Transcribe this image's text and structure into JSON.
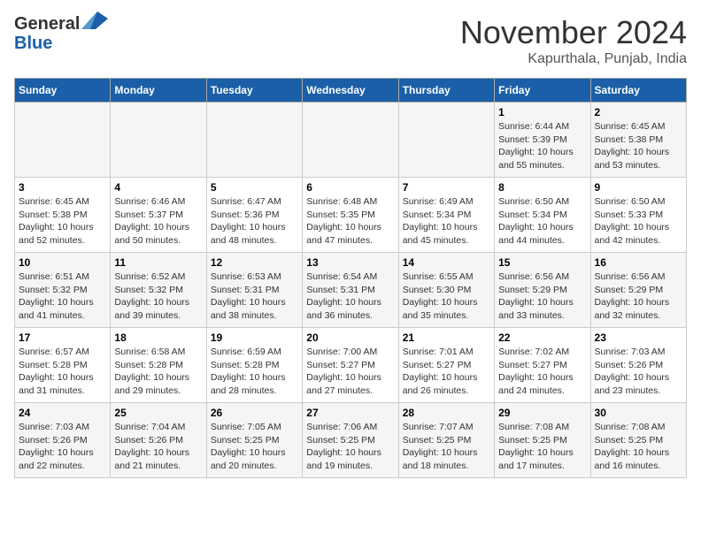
{
  "header": {
    "logo_line1": "General",
    "logo_line2": "Blue",
    "month": "November 2024",
    "location": "Kapurthala, Punjab, India"
  },
  "weekdays": [
    "Sunday",
    "Monday",
    "Tuesday",
    "Wednesday",
    "Thursday",
    "Friday",
    "Saturday"
  ],
  "weeks": [
    [
      {
        "day": "",
        "info": ""
      },
      {
        "day": "",
        "info": ""
      },
      {
        "day": "",
        "info": ""
      },
      {
        "day": "",
        "info": ""
      },
      {
        "day": "",
        "info": ""
      },
      {
        "day": "1",
        "info": "Sunrise: 6:44 AM\nSunset: 5:39 PM\nDaylight: 10 hours and 55 minutes."
      },
      {
        "day": "2",
        "info": "Sunrise: 6:45 AM\nSunset: 5:38 PM\nDaylight: 10 hours and 53 minutes."
      }
    ],
    [
      {
        "day": "3",
        "info": "Sunrise: 6:45 AM\nSunset: 5:38 PM\nDaylight: 10 hours and 52 minutes."
      },
      {
        "day": "4",
        "info": "Sunrise: 6:46 AM\nSunset: 5:37 PM\nDaylight: 10 hours and 50 minutes."
      },
      {
        "day": "5",
        "info": "Sunrise: 6:47 AM\nSunset: 5:36 PM\nDaylight: 10 hours and 48 minutes."
      },
      {
        "day": "6",
        "info": "Sunrise: 6:48 AM\nSunset: 5:35 PM\nDaylight: 10 hours and 47 minutes."
      },
      {
        "day": "7",
        "info": "Sunrise: 6:49 AM\nSunset: 5:34 PM\nDaylight: 10 hours and 45 minutes."
      },
      {
        "day": "8",
        "info": "Sunrise: 6:50 AM\nSunset: 5:34 PM\nDaylight: 10 hours and 44 minutes."
      },
      {
        "day": "9",
        "info": "Sunrise: 6:50 AM\nSunset: 5:33 PM\nDaylight: 10 hours and 42 minutes."
      }
    ],
    [
      {
        "day": "10",
        "info": "Sunrise: 6:51 AM\nSunset: 5:32 PM\nDaylight: 10 hours and 41 minutes."
      },
      {
        "day": "11",
        "info": "Sunrise: 6:52 AM\nSunset: 5:32 PM\nDaylight: 10 hours and 39 minutes."
      },
      {
        "day": "12",
        "info": "Sunrise: 6:53 AM\nSunset: 5:31 PM\nDaylight: 10 hours and 38 minutes."
      },
      {
        "day": "13",
        "info": "Sunrise: 6:54 AM\nSunset: 5:31 PM\nDaylight: 10 hours and 36 minutes."
      },
      {
        "day": "14",
        "info": "Sunrise: 6:55 AM\nSunset: 5:30 PM\nDaylight: 10 hours and 35 minutes."
      },
      {
        "day": "15",
        "info": "Sunrise: 6:56 AM\nSunset: 5:29 PM\nDaylight: 10 hours and 33 minutes."
      },
      {
        "day": "16",
        "info": "Sunrise: 6:56 AM\nSunset: 5:29 PM\nDaylight: 10 hours and 32 minutes."
      }
    ],
    [
      {
        "day": "17",
        "info": "Sunrise: 6:57 AM\nSunset: 5:28 PM\nDaylight: 10 hours and 31 minutes."
      },
      {
        "day": "18",
        "info": "Sunrise: 6:58 AM\nSunset: 5:28 PM\nDaylight: 10 hours and 29 minutes."
      },
      {
        "day": "19",
        "info": "Sunrise: 6:59 AM\nSunset: 5:28 PM\nDaylight: 10 hours and 28 minutes."
      },
      {
        "day": "20",
        "info": "Sunrise: 7:00 AM\nSunset: 5:27 PM\nDaylight: 10 hours and 27 minutes."
      },
      {
        "day": "21",
        "info": "Sunrise: 7:01 AM\nSunset: 5:27 PM\nDaylight: 10 hours and 26 minutes."
      },
      {
        "day": "22",
        "info": "Sunrise: 7:02 AM\nSunset: 5:27 PM\nDaylight: 10 hours and 24 minutes."
      },
      {
        "day": "23",
        "info": "Sunrise: 7:03 AM\nSunset: 5:26 PM\nDaylight: 10 hours and 23 minutes."
      }
    ],
    [
      {
        "day": "24",
        "info": "Sunrise: 7:03 AM\nSunset: 5:26 PM\nDaylight: 10 hours and 22 minutes."
      },
      {
        "day": "25",
        "info": "Sunrise: 7:04 AM\nSunset: 5:26 PM\nDaylight: 10 hours and 21 minutes."
      },
      {
        "day": "26",
        "info": "Sunrise: 7:05 AM\nSunset: 5:25 PM\nDaylight: 10 hours and 20 minutes."
      },
      {
        "day": "27",
        "info": "Sunrise: 7:06 AM\nSunset: 5:25 PM\nDaylight: 10 hours and 19 minutes."
      },
      {
        "day": "28",
        "info": "Sunrise: 7:07 AM\nSunset: 5:25 PM\nDaylight: 10 hours and 18 minutes."
      },
      {
        "day": "29",
        "info": "Sunrise: 7:08 AM\nSunset: 5:25 PM\nDaylight: 10 hours and 17 minutes."
      },
      {
        "day": "30",
        "info": "Sunrise: 7:08 AM\nSunset: 5:25 PM\nDaylight: 10 hours and 16 minutes."
      }
    ]
  ]
}
